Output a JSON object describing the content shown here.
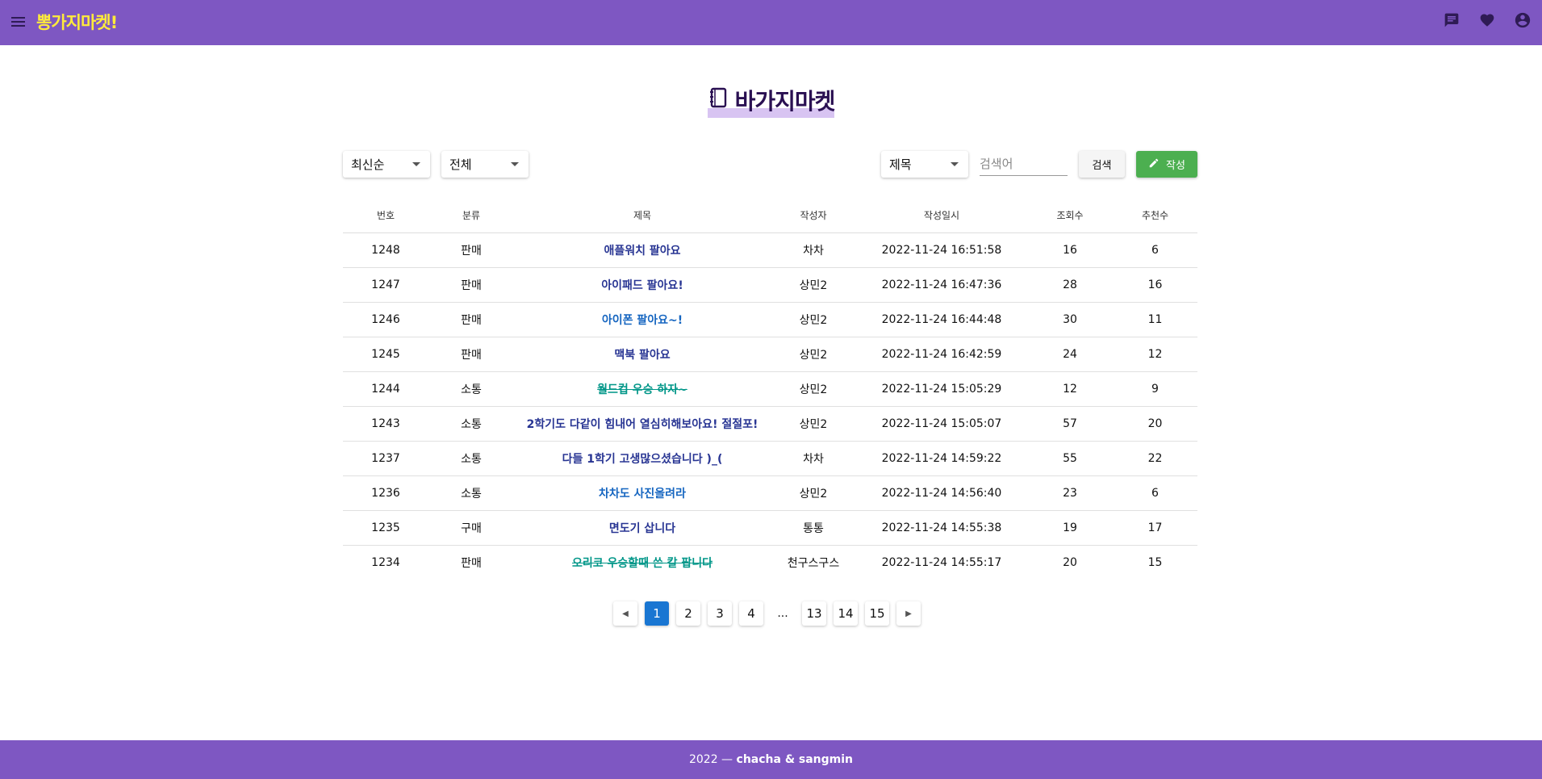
{
  "header": {
    "brand": "뽕가지마켓!",
    "icons": [
      "menu-icon",
      "chat-icon",
      "heart-icon",
      "account-icon"
    ]
  },
  "title": {
    "text": "바가지마켓",
    "icon": "notebook-icon"
  },
  "controls": {
    "sort": "최신순",
    "category": "전체",
    "search_field": "제목",
    "search_placeholder": "검색어",
    "search_button": "검색",
    "write_button": "작성"
  },
  "table": {
    "columns": [
      "번호",
      "분류",
      "제목",
      "작성자",
      "작성일시",
      "조회수",
      "추천수"
    ],
    "rows": [
      {
        "no": "1248",
        "cat": "판매",
        "title": "애플워치 팔아요",
        "author": "차차",
        "date": "2022-11-24 16:51:58",
        "views": "16",
        "likes": "6",
        "style": "normal"
      },
      {
        "no": "1247",
        "cat": "판매",
        "title": "아이패드 팔아요!",
        "author": "상민2",
        "date": "2022-11-24 16:47:36",
        "views": "28",
        "likes": "16",
        "style": "normal"
      },
      {
        "no": "1246",
        "cat": "판매",
        "title": "아이폰 팔아요~!",
        "author": "상민2",
        "date": "2022-11-24 16:44:48",
        "views": "30",
        "likes": "11",
        "style": "blue"
      },
      {
        "no": "1245",
        "cat": "판매",
        "title": "맥북 팔아요",
        "author": "상민2",
        "date": "2022-11-24 16:42:59",
        "views": "24",
        "likes": "12",
        "style": "normal"
      },
      {
        "no": "1244",
        "cat": "소통",
        "title": "월드컵 우승 하자~",
        "author": "상민2",
        "date": "2022-11-24 15:05:29",
        "views": "12",
        "likes": "9",
        "style": "strike"
      },
      {
        "no": "1243",
        "cat": "소통",
        "title": "2학기도 다같이 힘내어 열심히해보아요! 절절포!",
        "author": "상민2",
        "date": "2022-11-24 15:05:07",
        "views": "57",
        "likes": "20",
        "style": "normal"
      },
      {
        "no": "1237",
        "cat": "소통",
        "title": "다들 1학기 고생많으셨습니다 )_(",
        "author": "차차",
        "date": "2022-11-24 14:59:22",
        "views": "55",
        "likes": "22",
        "style": "normal"
      },
      {
        "no": "1236",
        "cat": "소통",
        "title": "차차도 사진올려라",
        "author": "상민2",
        "date": "2022-11-24 14:56:40",
        "views": "23",
        "likes": "6",
        "style": "blue"
      },
      {
        "no": "1235",
        "cat": "구매",
        "title": "면도기 삽니다",
        "author": "통통",
        "date": "2022-11-24 14:55:38",
        "views": "19",
        "likes": "17",
        "style": "normal"
      },
      {
        "no": "1234",
        "cat": "판매",
        "title": "오리코 우승할때 쓴 칼 팝니다",
        "author": "천구스구스",
        "date": "2022-11-24 14:55:17",
        "views": "20",
        "likes": "15",
        "style": "strike"
      }
    ]
  },
  "pagination": {
    "pages": [
      "1",
      "2",
      "3",
      "4",
      "...",
      "13",
      "14",
      "15"
    ],
    "current": "1"
  },
  "footer": {
    "year": "2022 —",
    "authors": "chacha & sangmin"
  },
  "colors": {
    "primary": "#7e57c2",
    "brand": "#ffeb3b",
    "write": "#4caf50",
    "active_page": "#1976d2",
    "link": "#283593",
    "link_blue": "#1565c0",
    "link_teal": "#009688"
  }
}
